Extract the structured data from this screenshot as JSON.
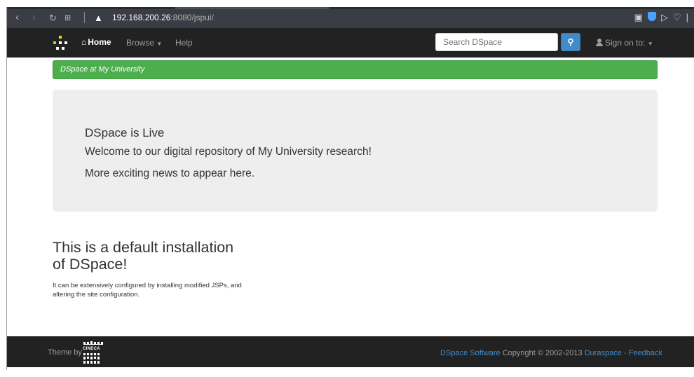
{
  "browser": {
    "url_host": "192.168.200.26",
    "url_rest": ":8080/jspui/",
    "back_icon": "chevron-left-icon",
    "forward_icon": "chevron-right-icon",
    "reload_icon": "reload-icon",
    "apps_icon": "grid-icon",
    "warning_icon": "warning-triangle-icon"
  },
  "navbar": {
    "home_label": "Home",
    "browse_label": "Browse",
    "help_label": "Help",
    "search_placeholder": "Search DSpace",
    "sign_on_label": "Sign on to:"
  },
  "breadcrumb": {
    "label": "DSpace at My University"
  },
  "jumbotron": {
    "heading": "DSpace is Live",
    "line1": "Welcome to our digital repository of My University research!",
    "line2": "More exciting news to appear here."
  },
  "intro": {
    "title": "This is a default installation of DSpace!",
    "text": "It can be extensively configured by installing modified JSPs, and altering the site configuration."
  },
  "footer": {
    "theme_by": "Theme by",
    "cineca_label": "CINECA",
    "software_link": "DSpace Software",
    "copyright": "Copyright © 2002-2013",
    "duraspace_link": "Duraspace",
    "separator": "-",
    "feedback_link": "Feedback"
  },
  "colors": {
    "navbar_bg": "#222222",
    "breadcrumb_green": "#4cae4c",
    "jumbotron_bg": "#eeeeee",
    "link_blue": "#428bca",
    "chrome_bg": "#3b3d45"
  }
}
